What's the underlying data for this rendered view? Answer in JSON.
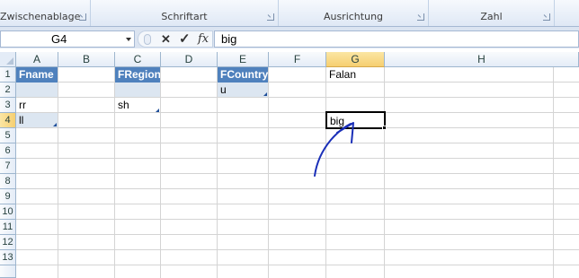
{
  "ribbon": {
    "groups": [
      "Zwischenablage",
      "Schriftart",
      "Ausrichtung",
      "Zahl"
    ]
  },
  "formula_bar": {
    "name_box": "G4",
    "cancel_icon": "✕",
    "confirm_icon": "✓",
    "fx_label": "fx",
    "content": "big"
  },
  "grid": {
    "columns": [
      "A",
      "B",
      "C",
      "D",
      "E",
      "F",
      "G",
      "H"
    ],
    "rows": [
      "1",
      "2",
      "3",
      "4",
      "5",
      "6",
      "7",
      "8",
      "9",
      "10",
      "11",
      "12",
      "13"
    ],
    "active_column": "G",
    "active_row": "4",
    "cells": {
      "A1": "Fname",
      "A3": "rr",
      "A4": "ll",
      "C1": "FRegion",
      "C3": "sh",
      "E1": "FCountry",
      "E2": "u",
      "G1": "Falan",
      "G4": "big"
    }
  },
  "colors": {
    "table_header": "#4f81bd",
    "table_band": "#dce6f1",
    "active_header": "#f6cf70",
    "annotation_arrow": "#1a2fb8"
  },
  "icons": [
    "dropdown-arrow-icon",
    "cancel-icon",
    "confirm-icon",
    "function-icon",
    "dialog-launcher-icon"
  ]
}
